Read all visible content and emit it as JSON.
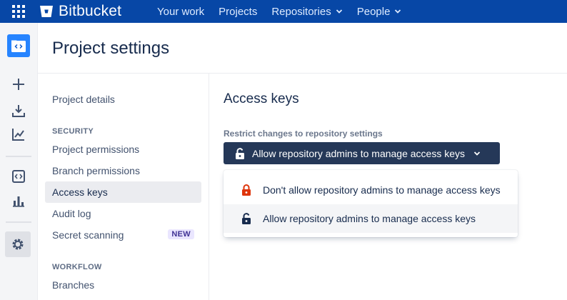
{
  "app": {
    "name": "Bitbucket"
  },
  "topnav": {
    "items": [
      {
        "label": "Your work",
        "has_menu": false
      },
      {
        "label": "Projects",
        "has_menu": false
      },
      {
        "label": "Repositories",
        "has_menu": true
      },
      {
        "label": "People",
        "has_menu": true
      }
    ]
  },
  "global_sidebar": {
    "icons": [
      "project-avatar-icon",
      "create-icon",
      "import-icon",
      "insights-icon",
      "code-icon",
      "reports-icon",
      "settings-icon"
    ]
  },
  "page": {
    "title": "Project settings"
  },
  "settings_nav": {
    "top_items": [
      {
        "label": "Project details"
      }
    ],
    "security_heading": "SECURITY",
    "security_items": [
      {
        "label": "Project permissions"
      },
      {
        "label": "Branch permissions"
      },
      {
        "label": "Access keys",
        "active": true
      },
      {
        "label": "Audit log"
      },
      {
        "label": "Secret scanning",
        "badge": "NEW"
      }
    ],
    "workflow_heading": "WORKFLOW",
    "workflow_items": [
      {
        "label": "Branches"
      }
    ]
  },
  "main": {
    "title": "Access keys",
    "restrict_label": "Restrict changes to repository settings",
    "selected_value": "Allow repository admins to manage access keys",
    "options": [
      {
        "label": "Don't allow repository admins to manage access keys",
        "icon": "locked-icon",
        "color": "#de350b"
      },
      {
        "label": "Allow repository admins to manage access keys",
        "icon": "unlocked-icon",
        "color": "#172b4d",
        "selected": true
      }
    ]
  },
  "colors": {
    "topbar": "#0747a6",
    "select_button": "#253858",
    "badge_bg": "#eae6ff",
    "badge_text": "#403294",
    "lock_red": "#de350b"
  }
}
